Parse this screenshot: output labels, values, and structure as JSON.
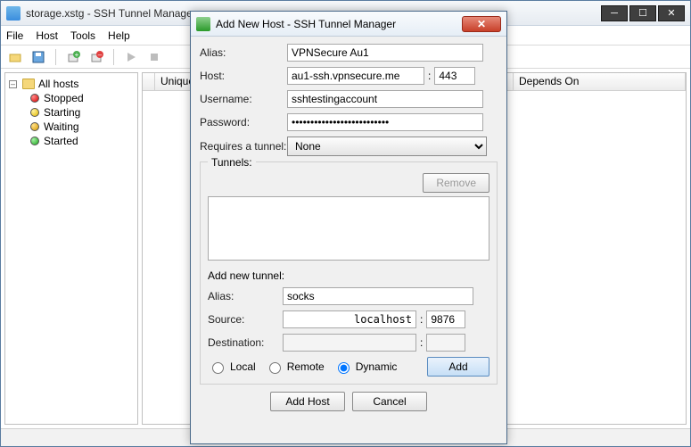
{
  "mainWindow": {
    "title": "storage.xstg - SSH Tunnel Manager",
    "menu": [
      "File",
      "Host",
      "Tools",
      "Help"
    ],
    "winControls": {
      "min": "─",
      "max": "☐",
      "close": "✕"
    }
  },
  "sidebar": {
    "root": "All hosts",
    "items": [
      {
        "label": "Stopped",
        "color": "red"
      },
      {
        "label": "Starting",
        "color": "yellow"
      },
      {
        "label": "Waiting",
        "color": "gold"
      },
      {
        "label": "Started",
        "color": "green"
      }
    ]
  },
  "listColumns": [
    "",
    "Unique",
    "",
    "Depends On"
  ],
  "dialog": {
    "title": "Add New Host - SSH Tunnel Manager",
    "labels": {
      "alias": "Alias:",
      "host": "Host:",
      "username": "Username:",
      "password": "Password:",
      "requires": "Requires a tunnel:",
      "tunnels": "Tunnels:",
      "addNewTunnel": "Add new tunnel:",
      "tAlias": "Alias:",
      "source": "Source:",
      "destination": "Destination:",
      "local": "Local",
      "remote": "Remote",
      "dynamic": "Dynamic"
    },
    "values": {
      "alias": "VPNSecure Au1",
      "host": "au1-ssh.vpnsecure.me",
      "port": "443",
      "username": "sshtestingaccount",
      "password": "••••••••••••••••••••••••••",
      "requires": "None",
      "tAlias": "socks",
      "sourceHost": "localhost",
      "sourcePort": "9876",
      "destHost": "",
      "destPort": "",
      "tunnelType": "dynamic"
    },
    "buttons": {
      "remove": "Remove",
      "add": "Add",
      "addHost": "Add Host",
      "cancel": "Cancel"
    }
  }
}
